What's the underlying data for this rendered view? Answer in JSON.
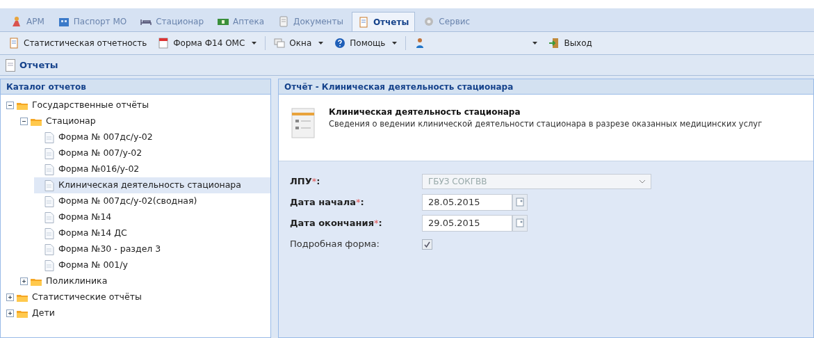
{
  "tabs": [
    {
      "label": "АРМ",
      "selected": false
    },
    {
      "label": "Паспорт МО",
      "selected": false
    },
    {
      "label": "Стационар",
      "selected": false
    },
    {
      "label": "Аптека",
      "selected": false
    },
    {
      "label": "Документы",
      "selected": false
    },
    {
      "label": "Отчеты",
      "selected": true
    },
    {
      "label": "Сервис",
      "selected": false
    }
  ],
  "toolbar": [
    {
      "kind": "button",
      "label": "Статистическая отчетность",
      "dropdown": false
    },
    {
      "kind": "button",
      "label": "Форма Ф14 ОМС",
      "dropdown": true
    },
    {
      "kind": "separator"
    },
    {
      "kind": "button",
      "label": "Окна",
      "dropdown": true
    },
    {
      "kind": "button",
      "label": "Помощь",
      "dropdown": true
    },
    {
      "kind": "separator"
    },
    {
      "kind": "user",
      "dropdown": true
    },
    {
      "kind": "button",
      "label": "Выход",
      "dropdown": false
    }
  ],
  "page_title": "Отчеты",
  "catalog": {
    "title": "Каталог отчетов",
    "tree": [
      {
        "label": "Государственные отчёты",
        "kind": "folder",
        "expanded": true,
        "selected": false,
        "children": [
          {
            "label": "Стационар",
            "kind": "folder",
            "expanded": true,
            "selected": false,
            "children": [
              {
                "label": "Форма № 007дс/у-02",
                "kind": "report",
                "selected": false
              },
              {
                "label": "Форма № 007/у-02",
                "kind": "report",
                "selected": false
              },
              {
                "label": "Форма №016/у-02",
                "kind": "report",
                "selected": false
              },
              {
                "label": "Клиническая деятельность стационара",
                "kind": "report",
                "selected": true
              },
              {
                "label": "Форма № 007дс/у-02(сводная)",
                "kind": "report",
                "selected": false
              },
              {
                "label": "Форма №14",
                "kind": "report",
                "selected": false
              },
              {
                "label": "Форма №14 ДС",
                "kind": "report",
                "selected": false
              },
              {
                "label": "Форма №30 - раздел 3",
                "kind": "report",
                "selected": false
              },
              {
                "label": "Форма № 001/у",
                "kind": "report",
                "selected": false
              }
            ]
          },
          {
            "label": "Поликлиника",
            "kind": "folder",
            "expanded": false,
            "selected": false
          }
        ]
      },
      {
        "label": "Статистические отчёты",
        "kind": "folder",
        "expanded": false,
        "selected": false
      },
      {
        "label": "Дети",
        "kind": "folder",
        "expanded": false,
        "selected": false
      }
    ]
  },
  "report": {
    "title": "Отчёт - Клиническая деятельность стационара",
    "name": "Клиническая деятельность стационара",
    "description": "Сведения о ведении клинической деятельности стационара в разрезе оказанных медицинских услуг",
    "fields": [
      {
        "kind": "combo",
        "label": "ЛПУ",
        "required_mark": "*",
        "colon": ":",
        "bold": true,
        "value": "ГБУЗ СОКГВВ",
        "disabled": true
      },
      {
        "kind": "date",
        "label": "Дата начала",
        "required_mark": "*",
        "colon": ":",
        "bold": true,
        "value": "28.05.2015"
      },
      {
        "kind": "date",
        "label": "Дата окончания",
        "required_mark": "*",
        "colon": ":",
        "bold": true,
        "value": "29.05.2015"
      },
      {
        "kind": "checkbox",
        "label": "Подробная форма",
        "colon": ":",
        "bold": false,
        "checked": true
      }
    ]
  }
}
